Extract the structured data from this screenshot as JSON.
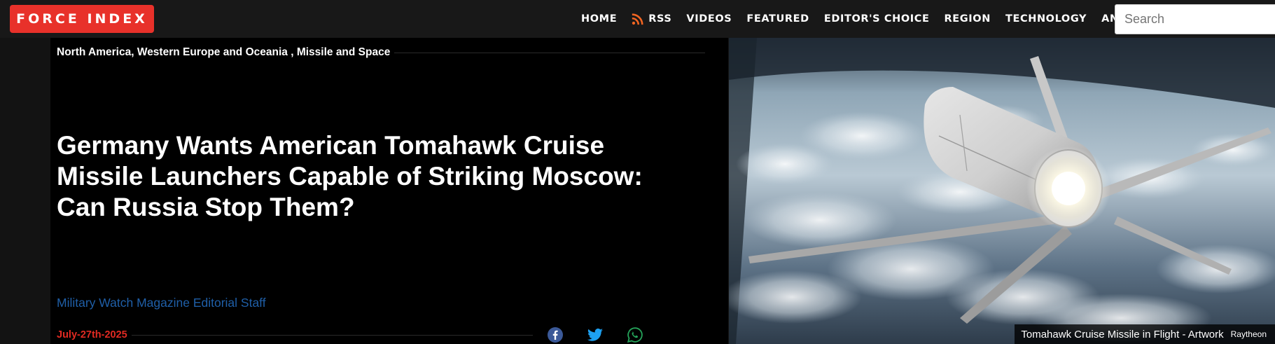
{
  "header": {
    "logo": "FORCE INDEX",
    "nav": [
      "HOME",
      "RSS",
      "VIDEOS",
      "FEATURED",
      "EDITOR'S CHOICE",
      "REGION",
      "TECHNOLOGY",
      "ANALYSIS"
    ],
    "search_placeholder": "Search"
  },
  "article": {
    "categories": "North America, Western Europe and Oceania , Missile and Space",
    "title": "Germany Wants American Tomahawk Cruise Missile Launchers Capable of Striking Moscow: Can Russia Stop Them?",
    "author": "Military Watch Magazine Editorial Staff",
    "date": "July-27th-2025",
    "share": [
      "facebook-icon",
      "twitter-icon",
      "whatsapp-icon"
    ]
  },
  "hero": {
    "caption": "Tomahawk Cruise Missile in Flight - Artwork",
    "credit": "Raytheon"
  },
  "colors": {
    "brand": "#e8312a",
    "author_link": "#1f5fa8",
    "date": "#e02a22",
    "rss": "#f26522"
  }
}
